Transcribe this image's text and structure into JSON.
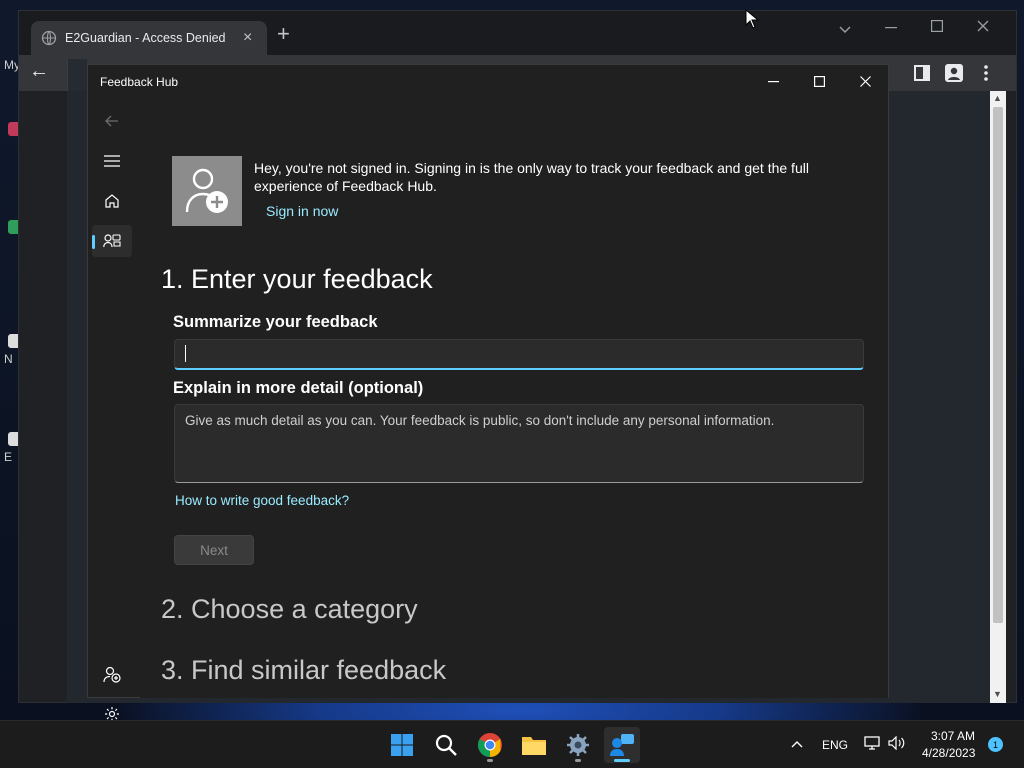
{
  "colors": {
    "accent": "#60cdff",
    "link": "#99ebff",
    "window_bg": "#202020",
    "taskbar_bg": "#1c1c1c"
  },
  "desktop": {
    "labels": [
      "My",
      "N",
      "E"
    ]
  },
  "browser": {
    "tab_title": "E2Guardian - Access Denied",
    "tab_close": "×",
    "new_tab": "+",
    "back": "←"
  },
  "feedback_hub": {
    "title": "Feedback Hub",
    "signin": {
      "message": "Hey, you're not signed in. Signing in is the only way to track your feedback and get the full experience of Feedback Hub.",
      "link": "Sign in now"
    },
    "step1": {
      "heading": "1. Enter your feedback",
      "summary_label": "Summarize your feedback",
      "summary_value": "",
      "detail_label": "Explain in more detail (optional)",
      "detail_placeholder": "Give as much detail as you can. Your feedback is public, so don't include any personal information.",
      "help_link": "How to write good feedback?",
      "next_button": "Next"
    },
    "step2": {
      "heading": "2. Choose a category"
    },
    "step3": {
      "heading": "3. Find similar feedback"
    },
    "nav_icons": [
      "back-icon",
      "menu-icon",
      "home-icon",
      "feedback-icon",
      "add-account-icon",
      "settings-icon"
    ]
  },
  "taskbar": {
    "apps": [
      "start-icon",
      "search-icon",
      "chrome-icon",
      "file-explorer-icon",
      "settings-icon",
      "feedback-hub-icon"
    ],
    "language": "ENG",
    "time": "3:07 AM",
    "date": "4/28/2023",
    "notification_count": "1"
  }
}
